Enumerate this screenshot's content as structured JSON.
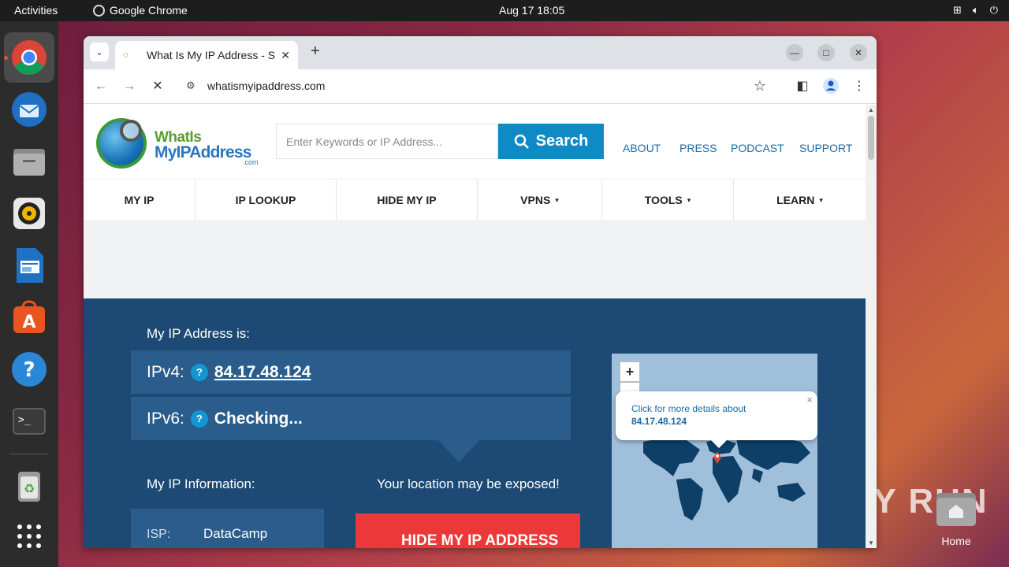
{
  "topbar": {
    "activities": "Activities",
    "app_name": "Google Chrome",
    "clock": "Aug 17  18:05"
  },
  "dock": {
    "items": [
      "chrome-icon",
      "thunderbird-icon",
      "files-icon",
      "rhythmbox-icon",
      "writer-icon",
      "app-center-icon",
      "help-icon",
      "terminal-icon",
      "trash-icon",
      "app-grid-icon"
    ]
  },
  "desktop": {
    "home_label": "Home",
    "watermark": "ANY RUN"
  },
  "browser": {
    "tab_title": "What Is My IP Address - S",
    "url": "whatismyipaddress.com"
  },
  "site": {
    "logo": {
      "line1": "WhatIs",
      "line2": "MyIPAddress",
      "line3": ".com"
    },
    "search_placeholder": "Enter Keywords or IP Address...",
    "search_button": "Search",
    "top_links": [
      "ABOUT",
      "PRESS",
      "PODCAST",
      "SUPPORT"
    ],
    "menu": [
      {
        "label": "MY IP",
        "caret": ""
      },
      {
        "label": "IP LOOKUP",
        "caret": ""
      },
      {
        "label": "HIDE MY IP",
        "caret": ""
      },
      {
        "label": "VPNS",
        "caret": "▾"
      },
      {
        "label": "TOOLS",
        "caret": "▾"
      },
      {
        "label": "LEARN",
        "caret": "▾"
      }
    ],
    "hero": {
      "my_ip_label": "My IP Address is:",
      "ipv4_label": "IPv4:",
      "ipv4_value": "84.17.48.124",
      "ipv6_label": "IPv6:",
      "ipv6_value": "Checking...",
      "help_glyph": "?",
      "info_label": "My IP Information:",
      "exposed_text": "Your location may be exposed!",
      "isp_key": "ISP:",
      "isp_value": "DataCamp",
      "hide_button": "HIDE MY IP ADDRESS"
    },
    "map": {
      "zoom_in": "+",
      "zoom_out": "-",
      "popup_line1": "Click for more details about",
      "popup_ip": "84.17.48.124",
      "popup_close": "×",
      "water_color": "#9fbfdb",
      "land_color": "#0e3f66",
      "marker_color": "#e04a2a"
    }
  }
}
